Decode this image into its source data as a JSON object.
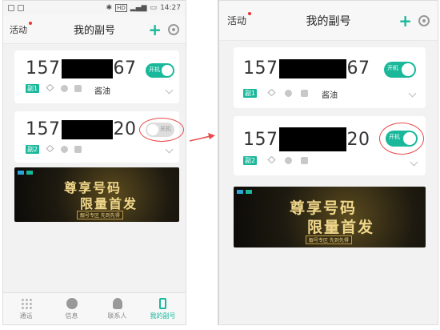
{
  "left_screen": {
    "status": {
      "time": "14:27",
      "hd": "HD"
    },
    "header": {
      "activity": "活动",
      "title": "我的副号"
    },
    "cards": [
      {
        "prefix": "157",
        "suffix": "67",
        "badge": "副1",
        "label": "酱油",
        "toggle_state": "on",
        "toggle_label": "开机"
      },
      {
        "prefix": "157",
        "suffix": "20",
        "badge": "副2",
        "label": "",
        "toggle_state": "off",
        "toggle_label": "关机"
      }
    ],
    "banner": {
      "title_line1": "尊享号码",
      "title_line2": "限量首发",
      "subtitle": "靓号专区 先到先得"
    },
    "tabs": [
      {
        "label": "通话",
        "icon": "dialpad-icon",
        "active": false
      },
      {
        "label": "信息",
        "icon": "message-icon",
        "active": false
      },
      {
        "label": "联系人",
        "icon": "contacts-icon",
        "active": false
      },
      {
        "label": "我的副号",
        "icon": "sub-number-icon",
        "active": true
      }
    ]
  },
  "right_screen": {
    "header": {
      "activity": "活动",
      "title": "我的副号"
    },
    "cards": [
      {
        "prefix": "157",
        "suffix": "67",
        "badge": "副1",
        "label": "酱油",
        "toggle_state": "on",
        "toggle_label": "开机"
      },
      {
        "prefix": "157",
        "suffix": "20",
        "badge": "副2",
        "label": "",
        "toggle_state": "on",
        "toggle_label": "开机"
      }
    ],
    "banner": {
      "title_line1": "尊享号码",
      "title_line2": "限量首发",
      "subtitle": "靓号专区 先到先得"
    }
  },
  "colors": {
    "accent": "#19b89b",
    "highlight_ring": "#e74c4c",
    "arrow": "#e74c4c"
  }
}
